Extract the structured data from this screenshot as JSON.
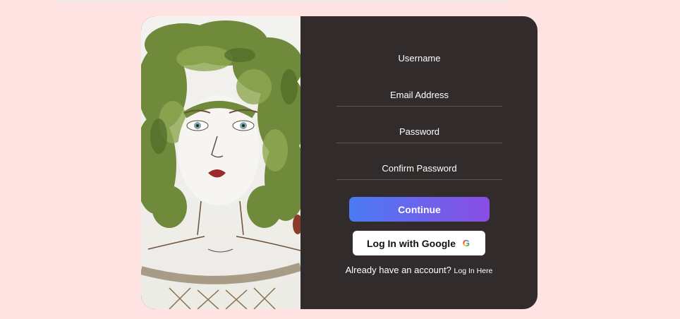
{
  "form": {
    "fields": [
      {
        "label": "Username"
      },
      {
        "label": "Email Address"
      },
      {
        "label": "Password"
      },
      {
        "label": "Confirm Password"
      }
    ],
    "continue_label": "Continue",
    "google_label": "Log In with Google",
    "google_icon_glyph": "G",
    "already_text": "Already have an account?",
    "login_link": "Log In Here"
  },
  "colors": {
    "page_bg": "#ffe2e2",
    "panel_bg": "#322b2b",
    "button_gradient_start": "#4a7bf4",
    "button_gradient_end": "#8a4de3"
  },
  "icons": {
    "google": "google-g-icon",
    "art": "leaf-hair-portrait-image"
  }
}
